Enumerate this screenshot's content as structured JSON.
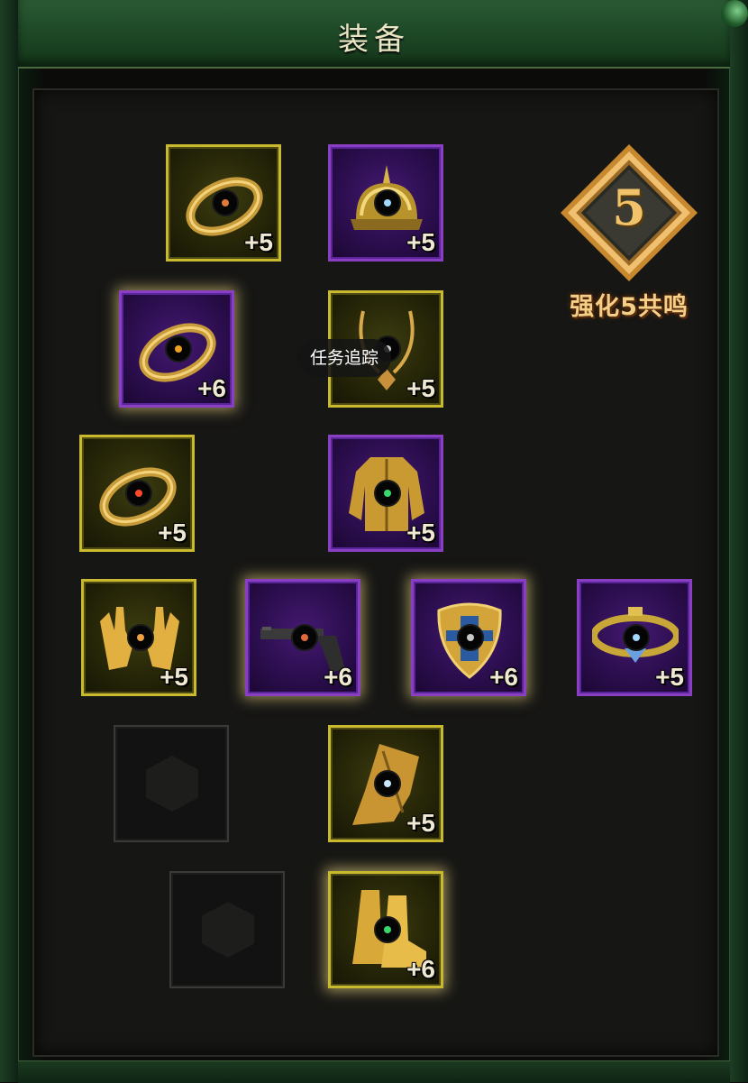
{
  "window": {
    "title": "装备"
  },
  "resonance": {
    "level": "5",
    "label": "强化5共鸣"
  },
  "tooltip": {
    "text": "任务追踪"
  },
  "slots": [
    {
      "id": "ring-1",
      "item": "ring-icon",
      "rarity": "gold",
      "plus": "+5",
      "gem": "#e07a3a"
    },
    {
      "id": "helmet",
      "item": "helmet-icon",
      "rarity": "purple",
      "plus": "+5",
      "gem": "#a0d8ff"
    },
    {
      "id": "ring-2",
      "item": "ring-icon",
      "rarity": "purple",
      "plus": "+6",
      "gem": "#f0a020"
    },
    {
      "id": "necklace",
      "item": "necklace-icon",
      "rarity": "gold",
      "plus": "+5",
      "gem": "#d0d0d0"
    },
    {
      "id": "ring-3",
      "item": "ring-icon",
      "rarity": "gold",
      "plus": "+5",
      "gem": "#ff4a2a"
    },
    {
      "id": "armor",
      "item": "armor-icon",
      "rarity": "purple",
      "plus": "+5",
      "gem": "#3ad86a"
    },
    {
      "id": "gloves",
      "item": "gloves-icon",
      "rarity": "gold",
      "plus": "+5",
      "gem": "#f0a040"
    },
    {
      "id": "weapon",
      "item": "pistol-icon",
      "rarity": "purple",
      "plus": "+6",
      "gem": "#e06a3a"
    },
    {
      "id": "shield",
      "item": "shield-icon",
      "rarity": "purple",
      "plus": "+6",
      "gem": "#c8c8c8"
    },
    {
      "id": "belt",
      "item": "belt-icon",
      "rarity": "purple",
      "plus": "+5",
      "gem": "#a0d8ff"
    },
    {
      "id": "empty-1",
      "item": "empty-slot",
      "rarity": "empty",
      "plus": ""
    },
    {
      "id": "pants",
      "item": "pants-icon",
      "rarity": "gold",
      "plus": "+5",
      "gem": "#c8e8ff"
    },
    {
      "id": "empty-2",
      "item": "empty-slot",
      "rarity": "empty",
      "plus": ""
    },
    {
      "id": "boots",
      "item": "boots-icon",
      "rarity": "gold",
      "plus": "+6",
      "gem": "#3ad86a"
    }
  ]
}
